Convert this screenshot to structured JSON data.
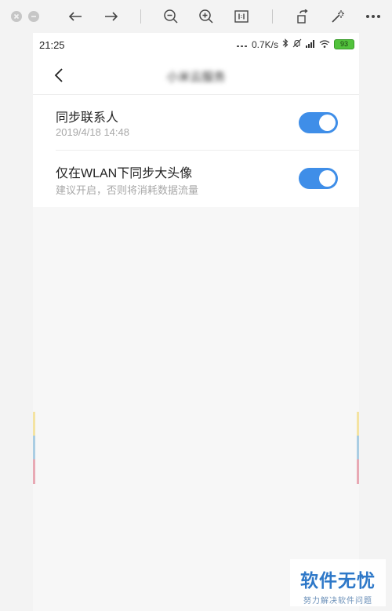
{
  "status_bar": {
    "time": "21:25",
    "network_speed": "0.7K/s",
    "battery_level": "93"
  },
  "navbar": {
    "title": "小米云服务"
  },
  "settings": [
    {
      "title": "同步联系人",
      "subtitle": "2019/4/18 14:48",
      "enabled": true
    },
    {
      "title": "仅在WLAN下同步大头像",
      "subtitle": "建议开启，否则将消耗数据流量",
      "enabled": true
    }
  ],
  "watermark": {
    "main": "软件无忧",
    "sub": "努力解决软件问题"
  },
  "colors": {
    "toggle_on": "#3f8ee8",
    "battery": "#52c23c"
  }
}
